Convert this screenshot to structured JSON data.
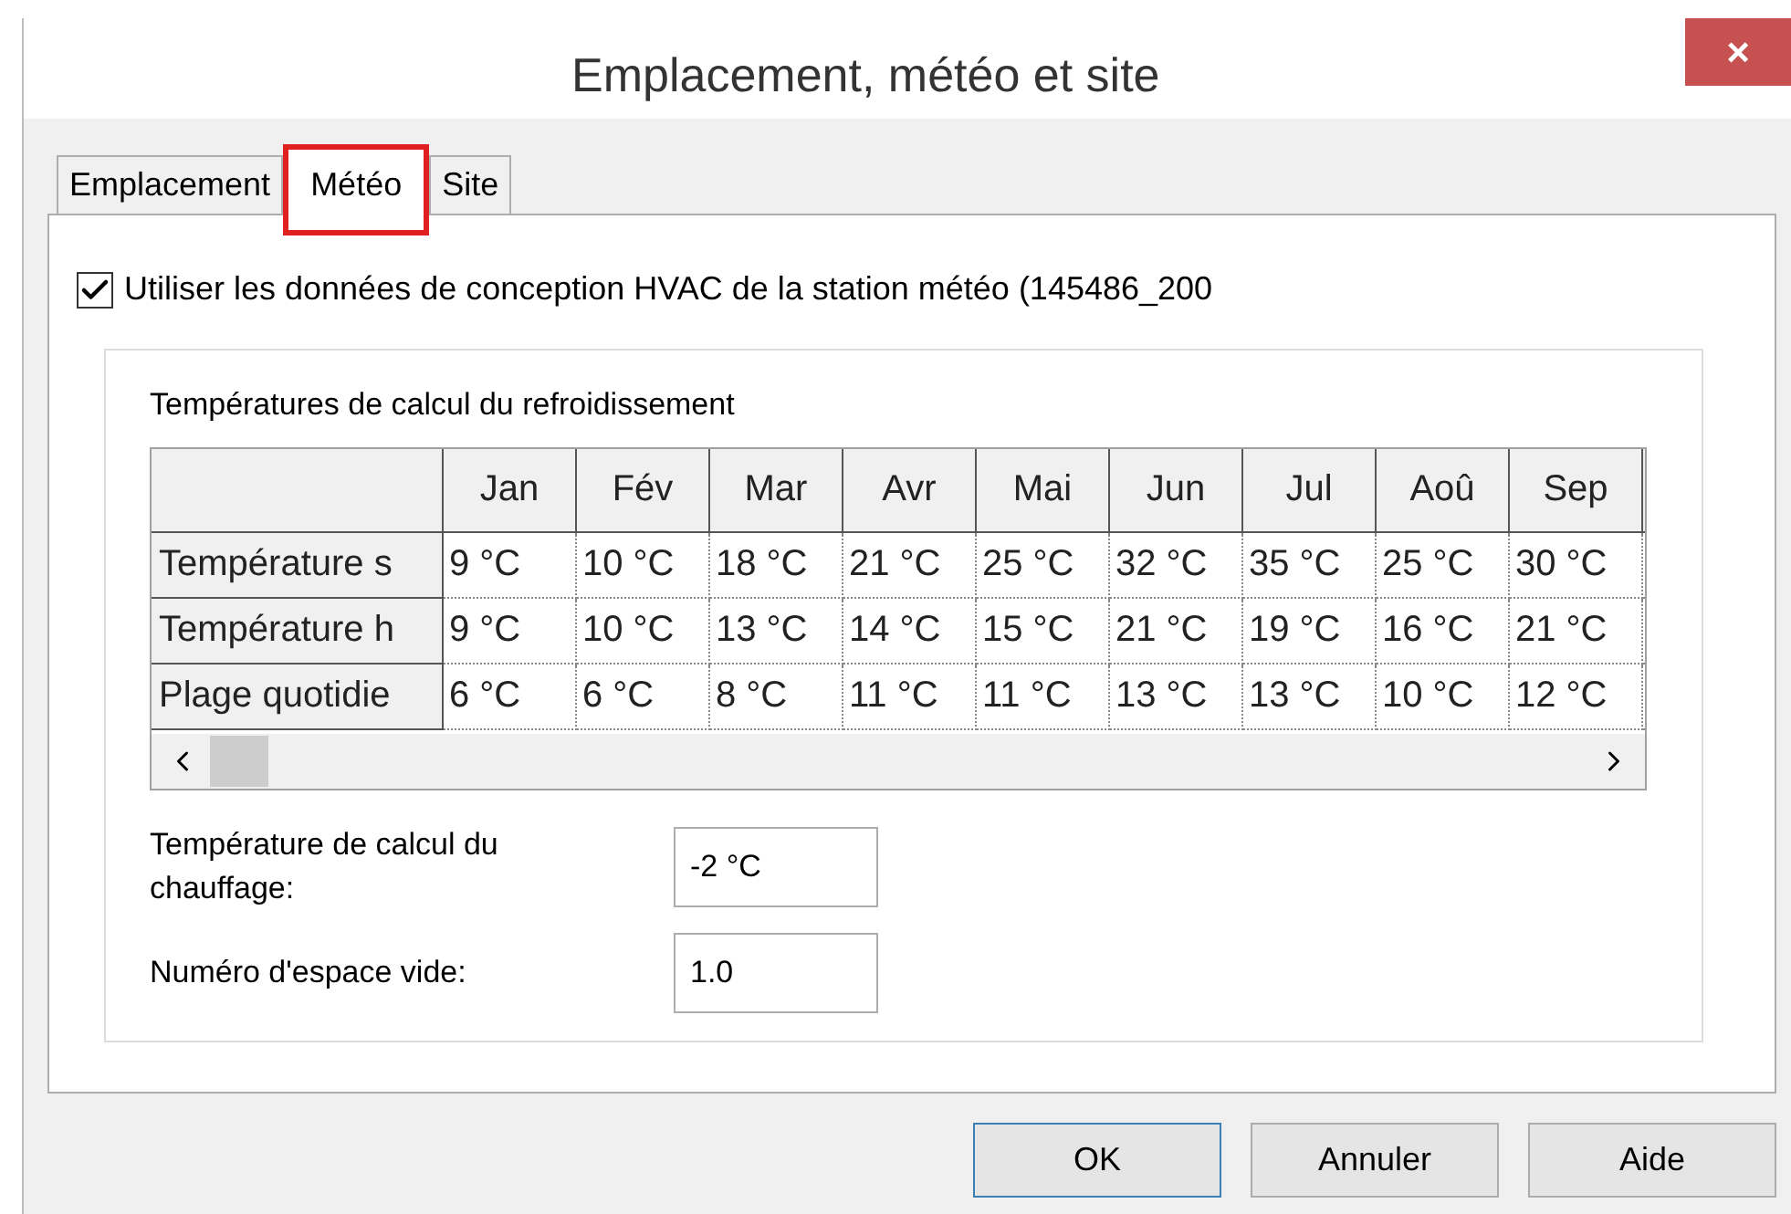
{
  "window": {
    "title": "Emplacement, météo et site",
    "close": "×"
  },
  "tabs": [
    {
      "label": "Emplacement",
      "selected": false
    },
    {
      "label": "Météo",
      "selected": true
    },
    {
      "label": "Site",
      "selected": false
    }
  ],
  "use_station": {
    "label": "Utiliser les données de conception HVAC de la station météo (145486_200",
    "checked": true
  },
  "cooling": {
    "title": "Températures de calcul du refroidissement",
    "columns": [
      "Jan",
      "Fév",
      "Mar",
      "Avr",
      "Mai",
      "Jun",
      "Jul",
      "Aoû",
      "Sep"
    ],
    "rows": [
      {
        "label": "Température s",
        "cells": [
          "9 °C",
          "10 °C",
          "18 °C",
          "21 °C",
          "25 °C",
          "32 °C",
          "35 °C",
          "25 °C",
          "30 °C"
        ]
      },
      {
        "label": "Température h",
        "cells": [
          "9 °C",
          "10 °C",
          "13 °C",
          "14 °C",
          "15 °C",
          "21 °C",
          "19 °C",
          "16 °C",
          "21 °C"
        ]
      },
      {
        "label": "Plage quotidie",
        "cells": [
          "6 °C",
          "6 °C",
          "8 °C",
          "11 °C",
          "11 °C",
          "13 °C",
          "13 °C",
          "10 °C",
          "12 °C"
        ]
      }
    ]
  },
  "fields": [
    {
      "label": "Température de calcul du chauffage:",
      "value": "-2 °C"
    },
    {
      "label": "Numéro d'espace vide:",
      "value": "1.0"
    }
  ],
  "buttons": [
    {
      "label": "OK",
      "focused": true
    },
    {
      "label": "Annuler",
      "focused": false
    },
    {
      "label": "Aide",
      "focused": false
    }
  ]
}
